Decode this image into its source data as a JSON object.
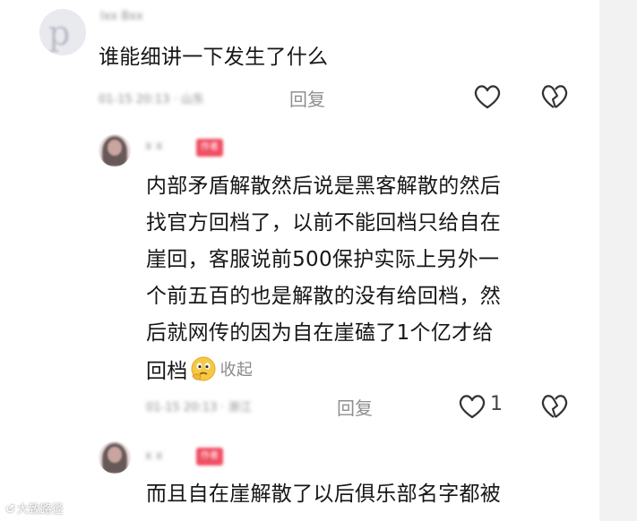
{
  "comments": [
    {
      "username": "Ixx Bxx",
      "text": "谁能细讲一下发生了什么",
      "meta": "01-15 20:13 · 山东",
      "reply_label": "回复",
      "like_count": ""
    },
    {
      "username": "x x",
      "tag": "作者",
      "text_lines": [
        "内部矛盾解散然后说是黑客解散的然后",
        "找官方回档了，以前不能回档只给自在",
        "崖回，客服说前500保护实际上另外一",
        "个前五百的也是解散的没有给回档，然",
        "后就网传的因为自在崖磕了1个亿才给",
        "回档"
      ],
      "collapse_label": "收起",
      "meta": "01-15 20:13 · 浙江",
      "reply_label": "回复",
      "like_count": "1"
    },
    {
      "username": "x x",
      "tag": "作者",
      "text_lines": [
        "而且自在崖解散了以后俱乐部名字都被"
      ]
    }
  ],
  "watermark": "大致路径",
  "colors": {
    "tag": "#f04e63",
    "muted": "#8f8f8f",
    "text": "#161616"
  },
  "icons": [
    "heart-outline-icon",
    "broken-heart-icon",
    "thinking-face-emoji"
  ]
}
